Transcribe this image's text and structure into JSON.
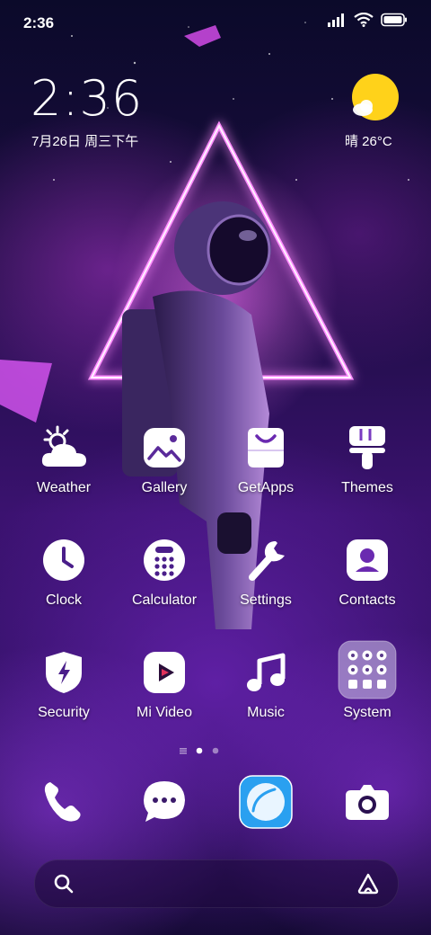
{
  "status_bar": {
    "time": "2:36"
  },
  "lock_widget": {
    "time": "2:36",
    "date": "7月26日 周三下午",
    "weather": "晴 26°C"
  },
  "apps": [
    {
      "label": "Weather",
      "icon": "weather-icon"
    },
    {
      "label": "Gallery",
      "icon": "gallery-icon"
    },
    {
      "label": "GetApps",
      "icon": "getapps-icon"
    },
    {
      "label": "Themes",
      "icon": "themes-icon"
    },
    {
      "label": "Clock",
      "icon": "clock-icon"
    },
    {
      "label": "Calculator",
      "icon": "calculator-icon"
    },
    {
      "label": "Settings",
      "icon": "settings-icon"
    },
    {
      "label": "Contacts",
      "icon": "contacts-icon"
    },
    {
      "label": "Security",
      "icon": "security-icon"
    },
    {
      "label": "Mi Video",
      "icon": "mi-video-icon"
    },
    {
      "label": "Music",
      "icon": "music-icon"
    },
    {
      "label": "System",
      "icon": "system-folder-icon"
    }
  ],
  "page_indicator": {
    "pages": 2,
    "current": 1
  },
  "dock": [
    {
      "icon": "phone-icon"
    },
    {
      "icon": "messages-icon"
    },
    {
      "icon": "browser-icon"
    },
    {
      "icon": "camera-icon"
    }
  ],
  "colors": {
    "accent_sun": "#ffd21a",
    "browser_blue": "#2aa0f0"
  }
}
